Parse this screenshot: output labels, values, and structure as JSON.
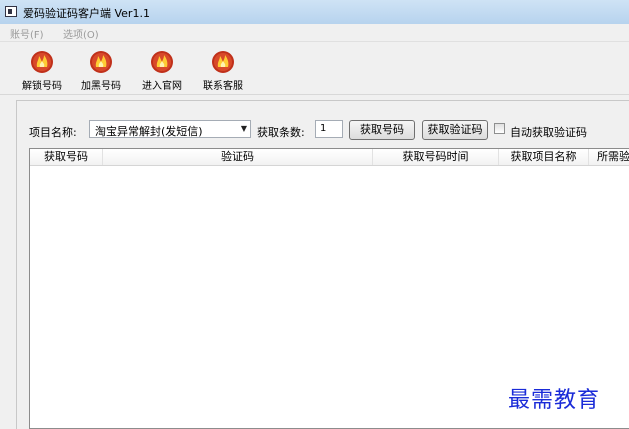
{
  "window": {
    "title": "爱码验证码客户端 Ver1.1"
  },
  "menu": [
    {
      "label": "账号(F)"
    },
    {
      "label": "选项(O)"
    }
  ],
  "toolbar": [
    {
      "label": "解锁号码",
      "icon": "flame-icon"
    },
    {
      "label": "加黑号码",
      "icon": "flame-icon"
    },
    {
      "label": "进入官网",
      "icon": "flame-icon"
    },
    {
      "label": "联系客服",
      "icon": "flame-icon"
    }
  ],
  "form": {
    "project_label": "项目名称:",
    "project_value": "淘宝异常解封(发短信)",
    "count_label": "获取条数:",
    "count_value": "1",
    "get_number_button": "获取号码",
    "get_code_button": "获取验证码",
    "auto_code_label": "自动获取验证码",
    "auto_code_checked": false
  },
  "table": {
    "columns": [
      "获取号码",
      "验证码",
      "获取号码时间",
      "获取项目名称",
      "所需验"
    ],
    "rows": []
  },
  "watermark": "最需教育",
  "colors": {
    "titlebar": "#b7d3ee",
    "icon_red": "#c0301a",
    "watermark": "#1a2bd8"
  }
}
